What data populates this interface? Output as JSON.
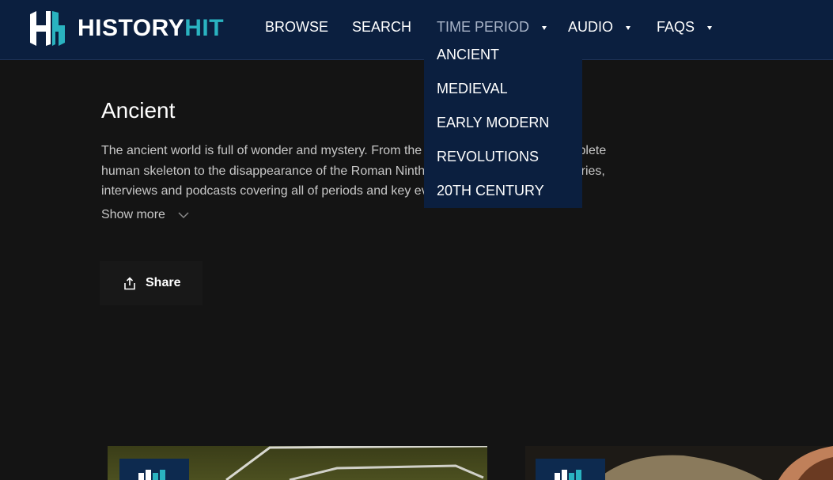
{
  "header": {
    "logo": {
      "word1": "HISTORY",
      "word2": "HIT"
    },
    "nav": [
      {
        "label": "BROWSE",
        "has_caret": false
      },
      {
        "label": "SEARCH",
        "has_caret": false
      },
      {
        "label": "TIME PERIOD",
        "has_caret": true,
        "active": true
      },
      {
        "label": "AUDIO",
        "has_caret": true
      },
      {
        "label": "FAQS",
        "has_caret": true
      }
    ]
  },
  "dropdown": {
    "items": [
      "ANCIENT",
      "MEDIEVAL",
      "EARLY MODERN",
      "REVOLUTIONS",
      "20TH CENTURY"
    ]
  },
  "main": {
    "title": "Ancient",
    "description_lines": [
      "The ancient world is full of wonder and mystery. From the discovery of the oldest complete",
      "human skeleton to the disappearance of the Roman Ninth Legion, explore documentaries,",
      "interviews and podcasts covering all of periods and key events. Learn more about this"
    ],
    "show_more": "Show more",
    "share": "Share"
  },
  "colors": {
    "header_bg": "#0b1f3f",
    "page_bg": "#141414",
    "accent": "#2ab3c0"
  },
  "icons": {
    "logo": "history-hit-logo-icon",
    "show_more": "chevron-down-icon",
    "share": "share-icon"
  }
}
